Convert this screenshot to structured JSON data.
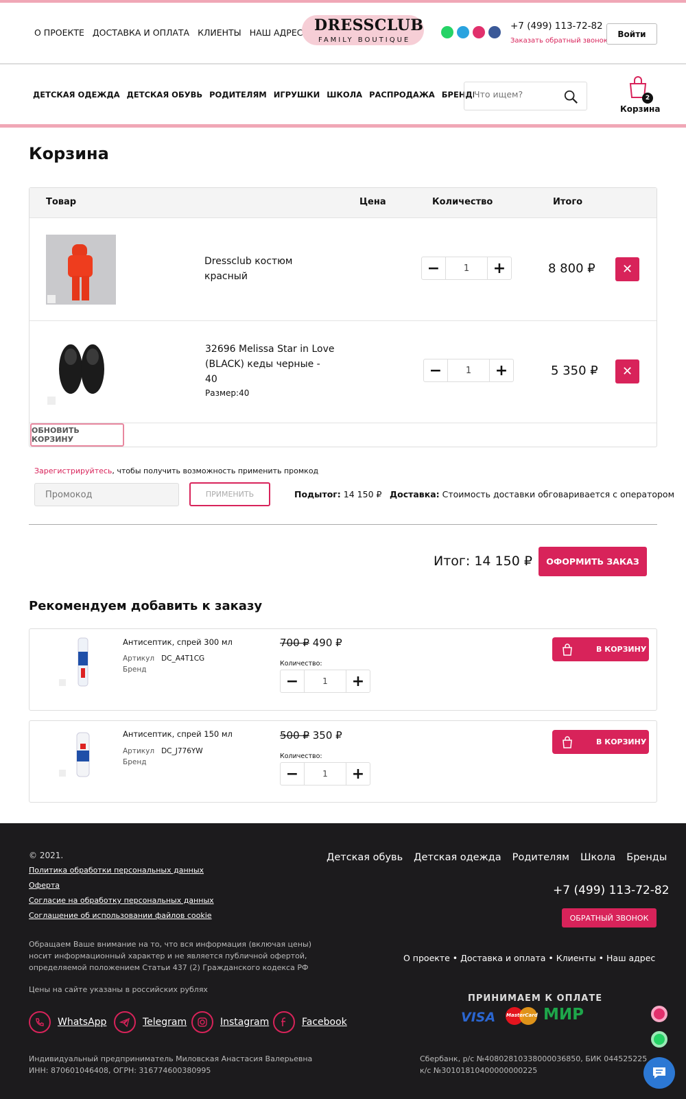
{
  "header": {
    "nav": [
      "О ПРОЕКТЕ",
      "ДОСТАВКА И ОПЛАТА",
      "КЛИЕНТЫ",
      "НАШ АДРЕС"
    ],
    "logo_main": "DRESSCLUB",
    "logo_sub": "FAMILY   BOUTIQUE",
    "phone": "+7 (499) 113-72-82",
    "callback": "Заказать обратный звонок",
    "login": "Войти"
  },
  "catnav": [
    "ДЕТСКАЯ ОДЕЖДА",
    "ДЕТСКАЯ ОБУВЬ",
    "РОДИТЕЛЯМ",
    "ИГРУШКИ",
    "ШКОЛА",
    "РАСПРОДАЖА",
    "БРЕНДЫ"
  ],
  "search": {
    "placeholder": "Что ищем?"
  },
  "cart": {
    "label": "Корзина",
    "count": "2"
  },
  "page_title": "Корзина",
  "table": {
    "headers": {
      "product": "Товар",
      "price": "Цена",
      "qty": "Количество",
      "total": "Итого"
    },
    "items": [
      {
        "name1": "Dressclub костюм",
        "name2": "красный",
        "name3": "",
        "size": "",
        "qty": "1",
        "total": "8 800 ₽"
      },
      {
        "name1": "32696 Melissa Star in Love",
        "name2": "(BLACK) кеды черные -",
        "name3": "40",
        "size": "Размер:40",
        "qty": "1",
        "total": "5 350 ₽"
      }
    ],
    "update": "ОБНОВИТЬ КОРЗИНУ"
  },
  "promo": {
    "register_link": "Зарегистрируйтесь",
    "register_text": ", чтобы получить возможность применить промкод",
    "placeholder": "Промокод",
    "apply": "ПРИМЕНИТЬ",
    "subtotal_label": "Подытог:",
    "subtotal": "14 150 ₽",
    "delivery_label": "Доставка:",
    "delivery": "Стоимость доставки обговаривается с оператором"
  },
  "summary": {
    "total": "Итог: 14 150 ₽",
    "checkout": "ОФОРМИТЬ ЗАКАЗ"
  },
  "recommend": {
    "title": "Рекомендуем добавить к заказу",
    "items": [
      {
        "name": "Антисептик, спрей 300 мл",
        "sku_label": "Артикул",
        "sku": "DC_A4T1CG",
        "brand": "Бренд",
        "old_price": "700 ₽",
        "price": "490 ₽",
        "qty_label": "Количество:",
        "qty": "1",
        "btn": "В КОРЗИНУ"
      },
      {
        "name": "Антисептик, спрей 150 мл",
        "sku_label": "Артикул",
        "sku": "DC_J776YW",
        "brand": "Бренд",
        "old_price": "500 ₽",
        "price": "350 ₽",
        "qty_label": "Количество:",
        "qty": "1",
        "btn": "В КОРЗИНУ"
      }
    ]
  },
  "footer": {
    "copyright": "© 2021.",
    "links": [
      "Политика обработки персональных данных",
      "Оферта",
      "Согласие на обработку персональных данных",
      "Соглашение об использовании файлов cookie"
    ],
    "nav": [
      "Детская обувь",
      "Детская одежда",
      "Родителям",
      "Школа",
      "Бренды"
    ],
    "phone": "+7 (499) 113-72-82",
    "callback": "ОБРАТНЫЙ ЗВОНОК",
    "note": "Обращаем Ваше внимание на то, что вся информация (включая цены) носит информационный характер и не является публичной офертой, определяемой положением Статьи 437 (2) Гражданского кодекса РФ",
    "currency": "Цены на сайте указаны в российских рублях",
    "menu": "О проекте  •  Доставка и оплата  •  Клиенты  •  Наш адрес",
    "payment_title": "ПРИНИМАЕМ К ОПЛАТЕ",
    "pay_visa": "VISA",
    "pay_mc": "MasterCard",
    "pay_mir": "МИР",
    "social": [
      "WhatsApp",
      "Telegram",
      "Instagram",
      "Facebook"
    ],
    "entrepreneur1": "Индивидуальный предприниматель Миловская Анастасия Валерьевна",
    "entrepreneur2": "ИНН: 870601046408, ОГРН: 316774600380995",
    "bank1": "Сбербанк, р/с №40802810338000036850, БИК 044525225",
    "bank2": "к/с №30101810400000000225"
  },
  "colors": {
    "accent": "#d8235a",
    "pink": "#f0a7b6",
    "footer_bg": "#1c1b1d"
  }
}
